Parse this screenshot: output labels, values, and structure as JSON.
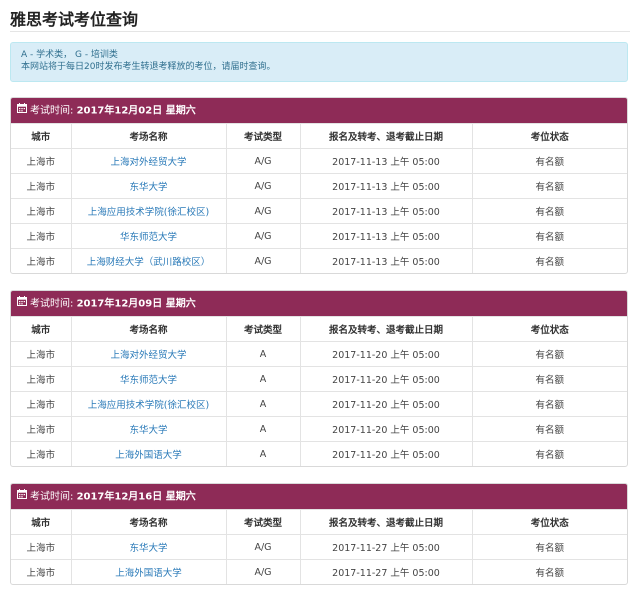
{
  "page": {
    "title": "雅思考试考位查询"
  },
  "notice": {
    "line1": "A - 学术类， G - 培训类",
    "line2": "本网站将于每日20时发布考生转退考释放的考位，请届时查询。"
  },
  "table_headers": {
    "city": "城市",
    "venue": "考场名称",
    "type": "考试类型",
    "deadline": "报名及转考、退考截止日期",
    "status": "考位状态"
  },
  "colors": {
    "panel_header": "#8e2b57",
    "link": "#2a7ab8",
    "notice_bg": "#d9edf7"
  },
  "sessions": [
    {
      "label": "考试时间:",
      "date": "2017年12月02日 星期六",
      "rows": [
        {
          "city": "上海市",
          "venue": "上海对外经贸大学",
          "type": "A/G",
          "deadline": "2017-11-13 上午 05:00",
          "status": "有名额"
        },
        {
          "city": "上海市",
          "venue": "东华大学",
          "type": "A/G",
          "deadline": "2017-11-13 上午 05:00",
          "status": "有名额"
        },
        {
          "city": "上海市",
          "venue": "上海应用技术学院(徐汇校区)",
          "type": "A/G",
          "deadline": "2017-11-13 上午 05:00",
          "status": "有名额"
        },
        {
          "city": "上海市",
          "venue": "华东师范大学",
          "type": "A/G",
          "deadline": "2017-11-13 上午 05:00",
          "status": "有名额"
        },
        {
          "city": "上海市",
          "venue": "上海财经大学（武川路校区）",
          "type": "A/G",
          "deadline": "2017-11-13 上午 05:00",
          "status": "有名额"
        }
      ]
    },
    {
      "label": "考试时间:",
      "date": "2017年12月09日 星期六",
      "rows": [
        {
          "city": "上海市",
          "venue": "上海对外经贸大学",
          "type": "A",
          "deadline": "2017-11-20 上午 05:00",
          "status": "有名额"
        },
        {
          "city": "上海市",
          "venue": "华东师范大学",
          "type": "A",
          "deadline": "2017-11-20 上午 05:00",
          "status": "有名额"
        },
        {
          "city": "上海市",
          "venue": "上海应用技术学院(徐汇校区)",
          "type": "A",
          "deadline": "2017-11-20 上午 05:00",
          "status": "有名额"
        },
        {
          "city": "上海市",
          "venue": "东华大学",
          "type": "A",
          "deadline": "2017-11-20 上午 05:00",
          "status": "有名额"
        },
        {
          "city": "上海市",
          "venue": "上海外国语大学",
          "type": "A",
          "deadline": "2017-11-20 上午 05:00",
          "status": "有名额"
        }
      ]
    },
    {
      "label": "考试时间:",
      "date": "2017年12月16日 星期六",
      "rows": [
        {
          "city": "上海市",
          "venue": "东华大学",
          "type": "A/G",
          "deadline": "2017-11-27 上午 05:00",
          "status": "有名额"
        },
        {
          "city": "上海市",
          "venue": "上海外国语大学",
          "type": "A/G",
          "deadline": "2017-11-27 上午 05:00",
          "status": "有名额"
        }
      ]
    }
  ]
}
